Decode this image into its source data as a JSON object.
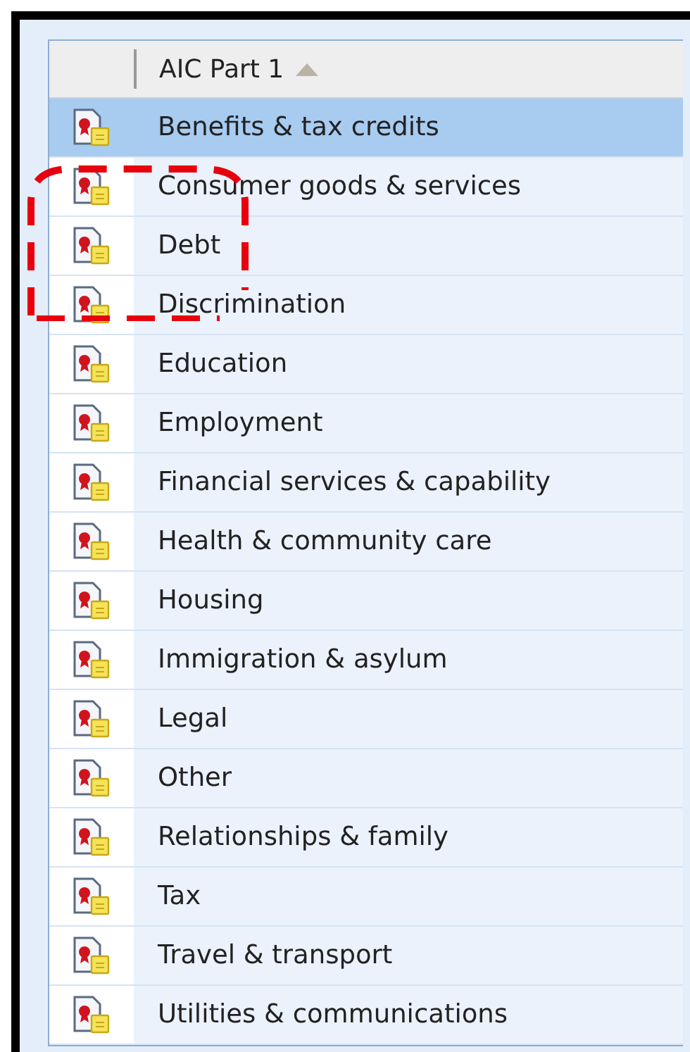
{
  "table": {
    "columns": [
      {
        "label": "AIC Part 1",
        "sorted": true,
        "ascending": true
      }
    ],
    "rows": [
      {
        "label": "Benefits & tax credits",
        "selected": true
      },
      {
        "label": "Consumer goods & services",
        "selected": false
      },
      {
        "label": "Debt",
        "selected": false
      },
      {
        "label": "Discrimination",
        "selected": false
      },
      {
        "label": "Education",
        "selected": false
      },
      {
        "label": "Employment",
        "selected": false
      },
      {
        "label": "Financial services & capability",
        "selected": false
      },
      {
        "label": "Health & community care",
        "selected": false
      },
      {
        "label": "Housing",
        "selected": false
      },
      {
        "label": "Immigration & asylum",
        "selected": false
      },
      {
        "label": "Legal",
        "selected": false
      },
      {
        "label": "Other",
        "selected": false
      },
      {
        "label": "Relationships & family",
        "selected": false
      },
      {
        "label": "Tax",
        "selected": false
      },
      {
        "label": "Travel & transport",
        "selected": false
      },
      {
        "label": "Utilities & communications",
        "selected": false
      }
    ]
  }
}
